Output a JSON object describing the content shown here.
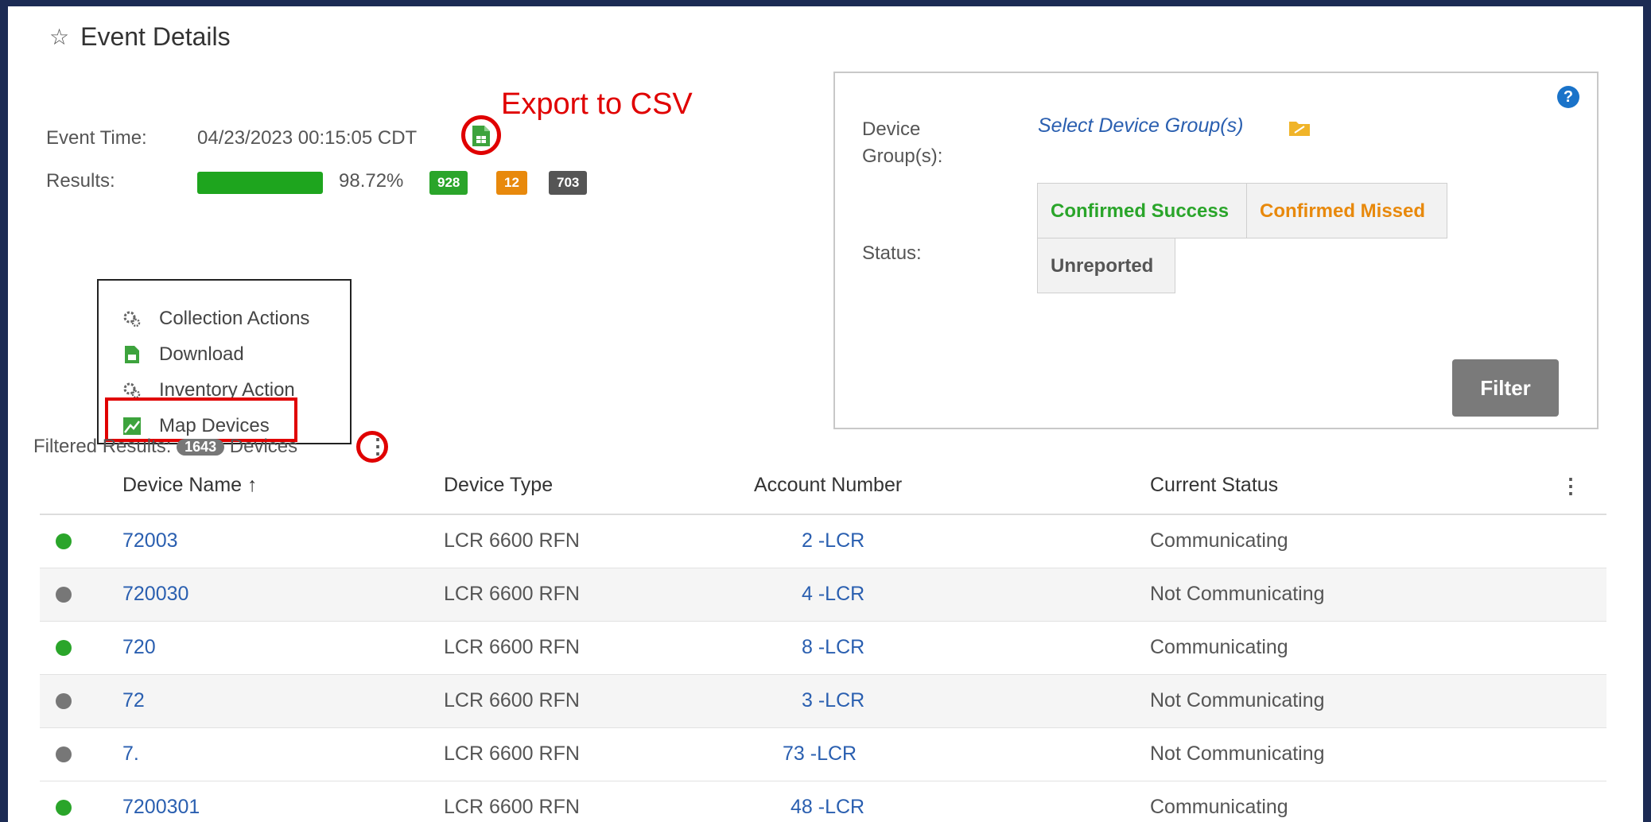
{
  "header": {
    "title": "Event Details",
    "star_glyph": "☆"
  },
  "annotation": {
    "export_label": "Export to CSV"
  },
  "event": {
    "time_label": "Event Time:",
    "time_value": "04/23/2023 00:15:05 CDT",
    "results_label": "Results:",
    "percent_text": "98.72%",
    "progress_fraction": 0.9872,
    "badges": {
      "success": "928",
      "missed": "12",
      "unreported": "703"
    }
  },
  "menu": {
    "items": [
      {
        "label": "Collection Actions",
        "icon": "gears-icon"
      },
      {
        "label": "Download",
        "icon": "csv-file-icon"
      },
      {
        "label": "Inventory Action",
        "icon": "gears-icon"
      },
      {
        "label": "Map Devices",
        "icon": "map-icon"
      }
    ]
  },
  "filtered": {
    "label": "Filtered Results:",
    "count": "1643",
    "suffix": "Devices"
  },
  "filter_panel": {
    "device_group_label_1": "Device",
    "device_group_label_2": "Group(s):",
    "device_group_link": "Select Device Group(s)",
    "status_label": "Status:",
    "status_buttons": {
      "success": "Confirmed Success",
      "missed": "Confirmed Missed",
      "unreported": "Unreported"
    },
    "filter_button": "Filter",
    "help_glyph": "?"
  },
  "table": {
    "columns": [
      "Device Name ↑",
      "Device Type",
      "Account Number",
      "Current Status"
    ],
    "rows": [
      {
        "status_color": "#2aa52a",
        "device_name": "72003",
        "device_type": "LCR 6600 RFN",
        "account": "2 -LCR",
        "current_status": "Communicating"
      },
      {
        "status_color": "#777777",
        "device_name": "720030",
        "device_type": "LCR 6600 RFN",
        "account": "4 -LCR",
        "current_status": "Not Communicating"
      },
      {
        "status_color": "#2aa52a",
        "device_name": "720",
        "device_type": "LCR 6600 RFN",
        "account": "8 -LCR",
        "current_status": "Communicating"
      },
      {
        "status_color": "#777777",
        "device_name": "72",
        "device_type": "LCR 6600 RFN",
        "account": "3 -LCR",
        "current_status": "Not Communicating"
      },
      {
        "status_color": "#777777",
        "device_name": "7.",
        "device_type": "LCR 6600 RFN",
        "account": "73 -LCR",
        "current_status": "Not Communicating"
      },
      {
        "status_color": "#2aa52a",
        "device_name": "7200301",
        "device_type": "LCR 6600 RFN",
        "account": "48 -LCR",
        "current_status": "Communicating"
      }
    ]
  },
  "colors": {
    "success": "#2aa52a",
    "missed": "#e8890c",
    "unreported": "#555555",
    "link": "#2a5fb0",
    "annotation_red": "#e00000"
  }
}
